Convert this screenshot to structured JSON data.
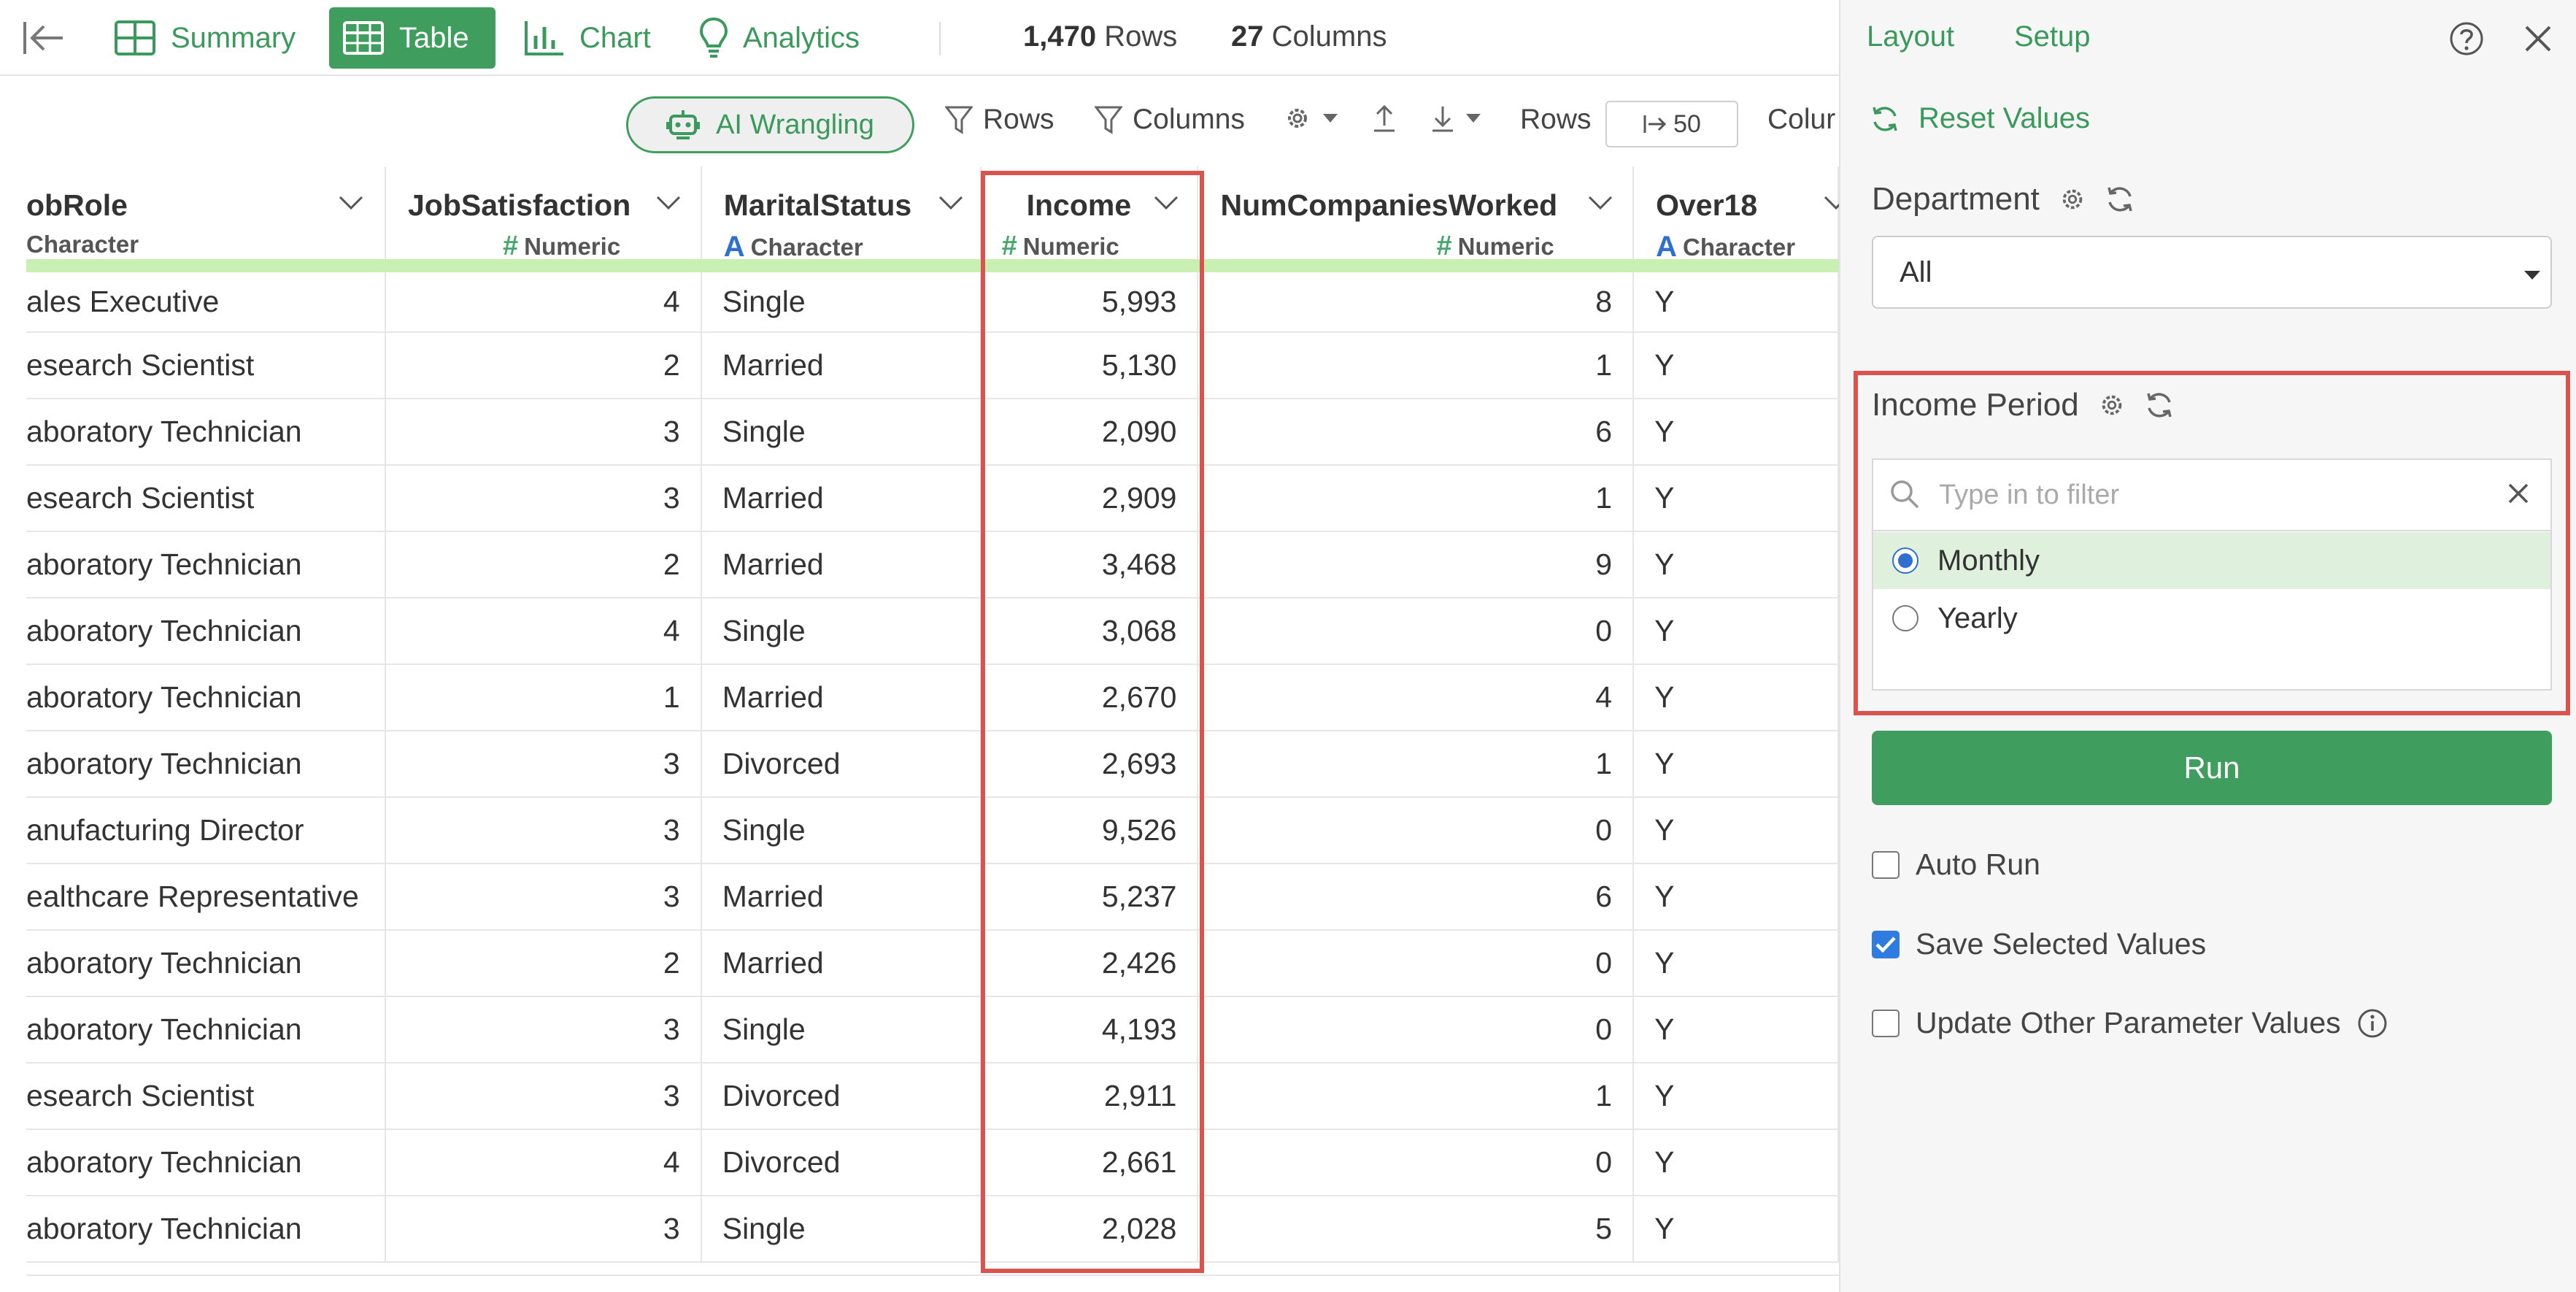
{
  "nav": {
    "tabs": [
      {
        "label": "Summary",
        "active": false
      },
      {
        "label": "Table",
        "active": true
      },
      {
        "label": "Chart",
        "active": false
      },
      {
        "label": "Analytics",
        "active": false
      }
    ],
    "rows_count": "1,470",
    "rows_label": "Rows",
    "columns_count": "27",
    "columns_label": "Columns"
  },
  "toolbar": {
    "ai_wrangling": "AI Wrangling",
    "rows_filter": "Rows",
    "columns_filter": "Columns",
    "rows_label": "Rows",
    "rows_value": "50",
    "columns_label_truncated": "Colur"
  },
  "table": {
    "columns": [
      {
        "name": "obRole",
        "type": "Character"
      },
      {
        "name": "JobSatisfaction",
        "type": "Numeric"
      },
      {
        "name": "MaritalStatus",
        "type": "Character"
      },
      {
        "name": "Income",
        "type": "Numeric"
      },
      {
        "name": "NumCompaniesWorked",
        "type": "Numeric"
      },
      {
        "name": "Over18",
        "type": "Character"
      }
    ],
    "rows": [
      [
        "ales Executive",
        "4",
        "Single",
        "5,993",
        "8",
        "Y"
      ],
      [
        "esearch Scientist",
        "2",
        "Married",
        "5,130",
        "1",
        "Y"
      ],
      [
        "aboratory Technician",
        "3",
        "Single",
        "2,090",
        "6",
        "Y"
      ],
      [
        "esearch Scientist",
        "3",
        "Married",
        "2,909",
        "1",
        "Y"
      ],
      [
        "aboratory Technician",
        "2",
        "Married",
        "3,468",
        "9",
        "Y"
      ],
      [
        "aboratory Technician",
        "4",
        "Single",
        "3,068",
        "0",
        "Y"
      ],
      [
        "aboratory Technician",
        "1",
        "Married",
        "2,670",
        "4",
        "Y"
      ],
      [
        "aboratory Technician",
        "3",
        "Divorced",
        "2,693",
        "1",
        "Y"
      ],
      [
        "anufacturing Director",
        "3",
        "Single",
        "9,526",
        "0",
        "Y"
      ],
      [
        "ealthcare Representative",
        "3",
        "Married",
        "5,237",
        "6",
        "Y"
      ],
      [
        "aboratory Technician",
        "2",
        "Married",
        "2,426",
        "0",
        "Y"
      ],
      [
        "aboratory Technician",
        "3",
        "Single",
        "4,193",
        "0",
        "Y"
      ],
      [
        "esearch Scientist",
        "3",
        "Divorced",
        "2,911",
        "1",
        "Y"
      ],
      [
        "aboratory Technician",
        "4",
        "Divorced",
        "2,661",
        "0",
        "Y"
      ],
      [
        "aboratory Technician",
        "3",
        "Single",
        "2,028",
        "5",
        "Y"
      ]
    ]
  },
  "panel": {
    "layout_tab": "Layout",
    "setup_tab": "Setup",
    "reset_values": "Reset Values",
    "department": {
      "label": "Department",
      "selected": "All"
    },
    "income_period": {
      "label": "Income Period",
      "filter_placeholder": "Type in to filter",
      "options": [
        {
          "label": "Monthly",
          "selected": true
        },
        {
          "label": "Yearly",
          "selected": false
        }
      ]
    },
    "run_button": "Run",
    "auto_run": {
      "label": "Auto Run",
      "checked": false
    },
    "save_selected_values": {
      "label": "Save Selected Values",
      "checked": true
    },
    "update_other_params": {
      "label": "Update Other Parameter Values",
      "checked": false
    }
  },
  "colors": {
    "accent_green": "#3f9e5e",
    "highlight_red": "#d9534f",
    "header_band": "#c9f0b3",
    "selected_row": "#dff0dc",
    "check_blue": "#2f7be0"
  }
}
